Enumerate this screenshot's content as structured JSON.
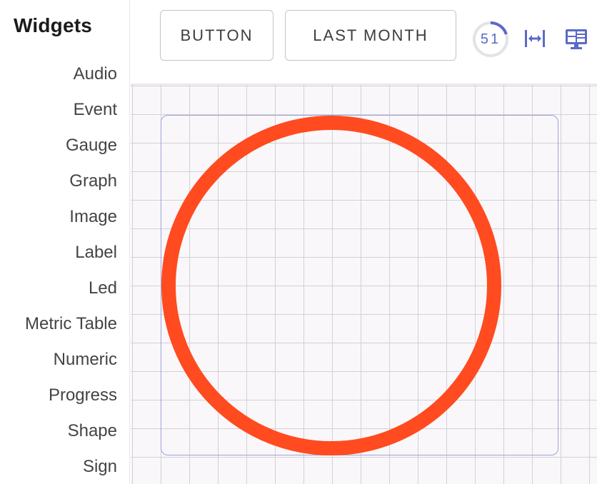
{
  "sidebar": {
    "title": "Widgets",
    "items": [
      {
        "label": "Audio"
      },
      {
        "label": "Event"
      },
      {
        "label": "Gauge"
      },
      {
        "label": "Graph"
      },
      {
        "label": "Image"
      },
      {
        "label": "Label"
      },
      {
        "label": "Led"
      },
      {
        "label": "Metric Table"
      },
      {
        "label": "Numeric"
      },
      {
        "label": "Progress"
      },
      {
        "label": "Shape"
      },
      {
        "label": "Sign"
      }
    ]
  },
  "toolbar": {
    "button_label": "BUTTON",
    "period_label": "LAST MONTH",
    "counter_value": "51",
    "counter_progress": 0.2,
    "fit_icon": "fit-width-icon",
    "monitor_icon": "monitor-dashboard-icon"
  },
  "canvas": {
    "shape": "circle",
    "shape_color": "#ff4b1f",
    "frame_color": "#9aa3d6",
    "grid_color": "#d3d1d6",
    "background_color": "#faf7fa"
  },
  "colors": {
    "accent": "#5b6ac7"
  }
}
